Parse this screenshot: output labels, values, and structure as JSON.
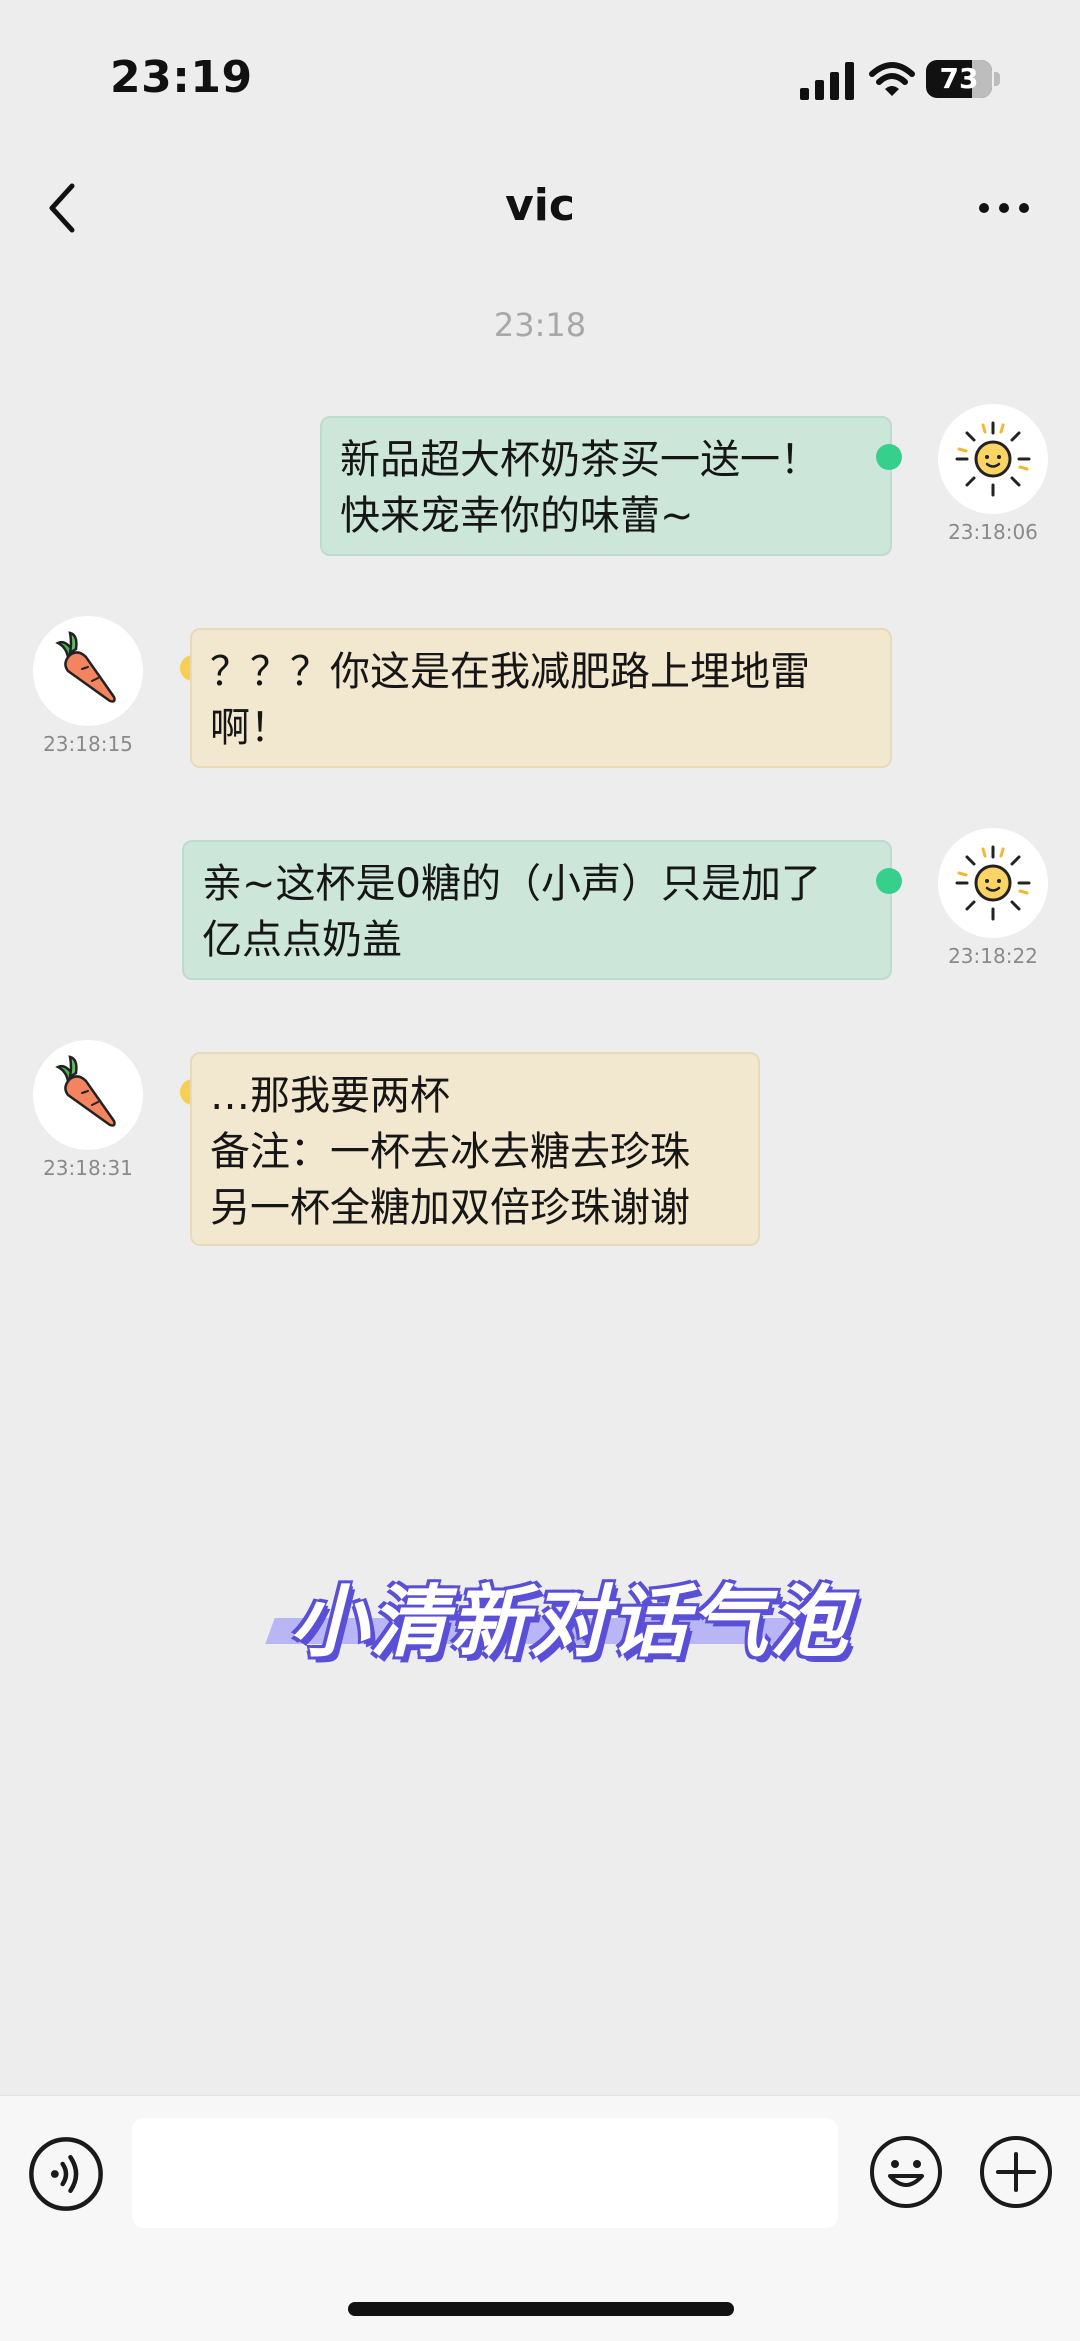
{
  "status_bar": {
    "time": "23:19",
    "battery": "73"
  },
  "header": {
    "title": "vic"
  },
  "time_divider": "23:18",
  "messages": [
    {
      "side": "right",
      "color": "green",
      "avatar": "sun-icon",
      "time": "23:18:06",
      "lines": [
        "新品超大杯奶茶买一送一！",
        "快来宠幸你的味蕾~"
      ]
    },
    {
      "side": "left",
      "color": "yellow",
      "avatar": "carrot-icon",
      "time": "23:18:15",
      "lines": [
        "？？？你这是在我减肥路上埋地雷",
        "啊！"
      ]
    },
    {
      "side": "right",
      "color": "green",
      "avatar": "sun-icon",
      "time": "23:18:22",
      "lines": [
        "亲~这杯是0糖的（小声）只是加了",
        "亿点点奶盖"
      ]
    },
    {
      "side": "left",
      "color": "yellow",
      "avatar": "carrot-icon",
      "time": "23:18:31",
      "lines": [
        "…那我要两杯",
        "备注：一杯去冰去糖去珍珠",
        "另一杯全糖加双倍珍珠谢谢"
      ]
    }
  ],
  "caption": "小清新对话气泡",
  "input": {
    "value": "",
    "placeholder": ""
  },
  "colors": {
    "green_bubble": "#cce7da",
    "yellow_bubble": "#f2e8cf",
    "green_dot": "#37cf8c",
    "yellow_dot": "#f7cf52",
    "caption_stroke": "#5a4fd7"
  }
}
